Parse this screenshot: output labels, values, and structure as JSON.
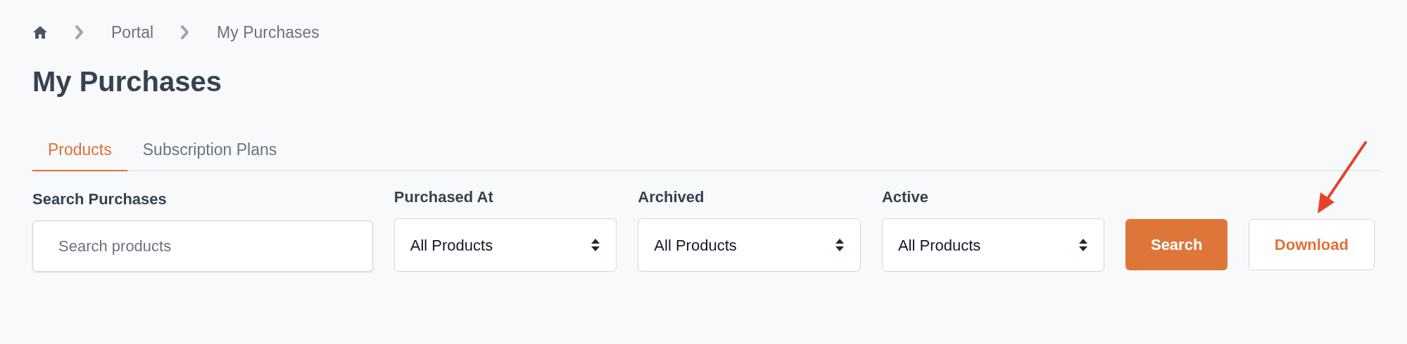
{
  "breadcrumb": [
    {
      "label": "Portal"
    },
    {
      "label": "My Purchases"
    }
  ],
  "title": "My Purchases",
  "tabs": [
    {
      "label": "Products",
      "selected": true
    },
    {
      "label": "Subscription Plans",
      "selected": false
    }
  ],
  "filters": [
    {
      "kind": "search",
      "label": "Search Purchases",
      "placeholder": "Search products"
    },
    {
      "kind": "select",
      "label": "Purchased At",
      "value": "All Products"
    },
    {
      "kind": "select",
      "label": "Archived",
      "value": "All Products"
    },
    {
      "kind": "select",
      "label": "Active",
      "value": "All Products"
    }
  ],
  "buttons": [
    {
      "kind": "primary",
      "label": "Search"
    },
    {
      "kind": "secondary",
      "label": "Download"
    }
  ]
}
